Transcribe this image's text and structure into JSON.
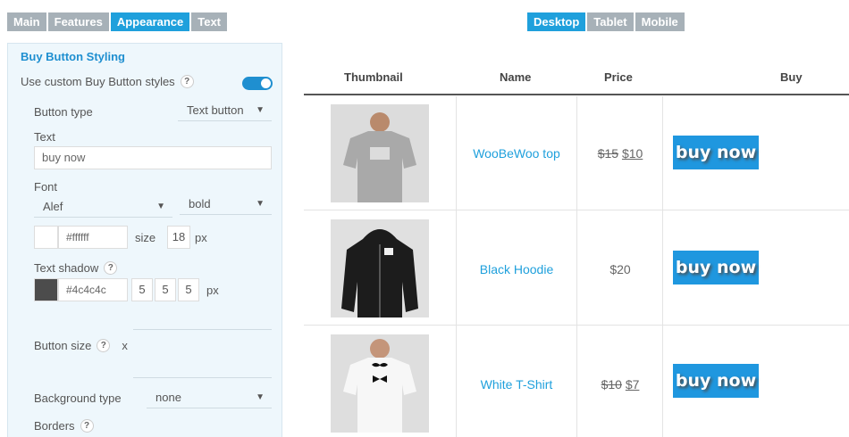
{
  "tabs": [
    "Main",
    "Features",
    "Appearance",
    "Text"
  ],
  "active_tab": "Appearance",
  "device_tabs": [
    "Desktop",
    "Tablet",
    "Mobile"
  ],
  "active_device": "Desktop",
  "panel": {
    "title": "Buy Button Styling",
    "use_custom_label": "Use custom Buy Button styles",
    "use_custom_enabled": true,
    "help_glyph": "?",
    "button_type_label": "Button type",
    "button_type_value": "Text button",
    "text_label": "Text",
    "text_value": "buy now",
    "font_label": "Font",
    "font_family_value": "Alef",
    "font_weight_value": "bold",
    "font_color_value": "#ffffff",
    "size_label": "size",
    "size_value": "18",
    "px_label": "px",
    "text_shadow_label": "Text shadow",
    "shadow_color_value": "#4c4c4c",
    "shadow_x": "5",
    "shadow_y": "5",
    "shadow_blur": "5",
    "button_size_label": "Button size",
    "button_size_x": "x",
    "background_type_label": "Background type",
    "background_type_value": "none",
    "borders_label": "Borders"
  },
  "table": {
    "headers": [
      "Thumbnail",
      "Name",
      "Price",
      "Buy"
    ],
    "rows": [
      {
        "name": "WooBeWoo top",
        "old_price": "$15",
        "price": "$10",
        "buy": "buy now",
        "shirt_color": "#a9a9a9"
      },
      {
        "name": "Black Hoodie",
        "old_price": "",
        "price": "$20",
        "buy": "buy now",
        "shirt_color": "#1c1c1c"
      },
      {
        "name": "White T-Shirt",
        "old_price": "$10",
        "price": "$7",
        "buy": "buy now",
        "shirt_color": "#f4f4f4"
      }
    ]
  },
  "colors": {
    "accent": "#1fa0dc",
    "tab_inactive": "#a7b1b8",
    "panel_bg": "#eef7fc"
  }
}
